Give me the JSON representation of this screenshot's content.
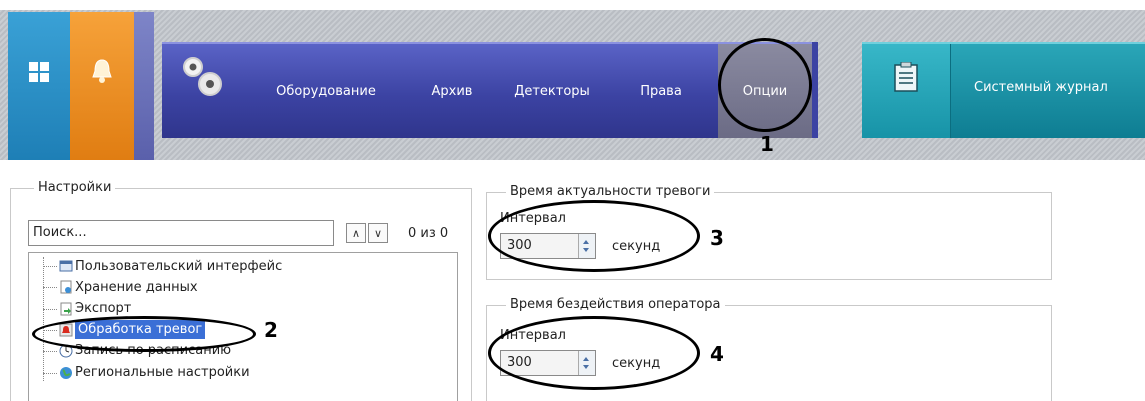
{
  "heading_partial": "...",
  "toolbar": {
    "nav_items": [
      "Оборудование",
      "Архив",
      "Детекторы",
      "Права",
      "Опции"
    ],
    "journal_label": "Системный журнал"
  },
  "callouts": [
    "1",
    "2",
    "3",
    "4"
  ],
  "settings": {
    "group_title": "Настройки",
    "search_placeholder": "Поиск...",
    "search_count": "0 из 0",
    "tree_items": [
      "Пользовательский интерфейс",
      "Хранение данных",
      "Экспорт",
      "Обработка тревог",
      "Запись по расписанию",
      "Региональные настройки"
    ]
  },
  "alarm_relevance": {
    "title": "Время актуальности тревоги",
    "interval_label": "Интервал",
    "value": "300",
    "unit": "секунд"
  },
  "operator_idle": {
    "title": "Время бездействия оператора",
    "interval_label": "Интервал",
    "value": "300",
    "unit": "секунд"
  },
  "colors": {
    "nav_bg": "#3c43a3",
    "journal_bg": "#0e7d92",
    "selected_bg": "#3b6fd6"
  }
}
